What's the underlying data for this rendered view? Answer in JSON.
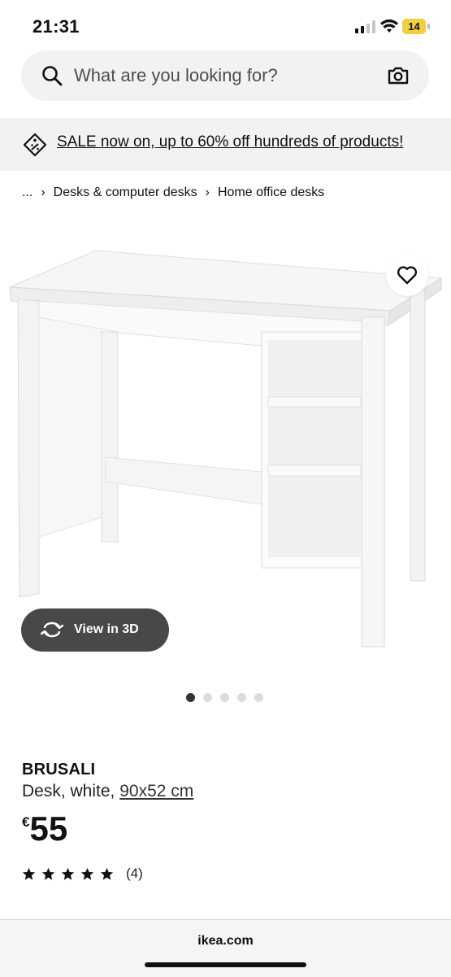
{
  "status_bar": {
    "time": "21:31",
    "battery_level": "14",
    "signal_bars": 2,
    "wifi_icon": "wifi-icon"
  },
  "search": {
    "placeholder": "What are you looking for?",
    "icon": "search-icon",
    "camera_icon": "camera-icon"
  },
  "sale_banner": {
    "icon": "tag-icon",
    "text": "SALE now on, up to 60% off hundreds of products!"
  },
  "breadcrumb": {
    "items": [
      "...",
      "Desks & computer desks",
      "Home office desks"
    ],
    "separator": "›"
  },
  "gallery": {
    "favourite_icon": "heart-icon",
    "view3d_label": "View in 3D",
    "view3d_icon": "rotate-3d-icon",
    "image_count": 5,
    "active_index": 0
  },
  "product": {
    "name": "BRUSALI",
    "description": "Desk, white, ",
    "size": "90x52 cm",
    "price_currency": "€",
    "price_value": "55",
    "rating_stars": 5,
    "review_count": "(4)"
  },
  "browser": {
    "domain": "ikea.com"
  },
  "colors": {
    "search_bg": "#f2f2f2",
    "view3d_bg": "#484848",
    "battery": "#f2ce45",
    "active_dot": "#333333",
    "inactive_dot": "#dcdcdc"
  }
}
